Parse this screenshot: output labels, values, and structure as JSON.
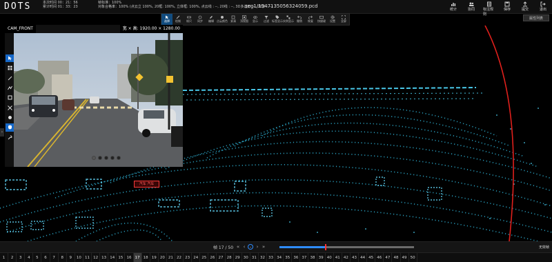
{
  "app": {
    "logo": "DOTS",
    "filename": "seg1/1547135056324059.pcd"
  },
  "metrics": [
    "本次时间 00：21：56",
    "帧标准：100%",
    "累计时间 01：33：23",
    "对象合格率：100% (点云立 100%, 20框: 100%, 立体框: 100%, 点云线 : --, 20线 : --, 3D多边形: --, 20多 : --)"
  ],
  "top_actions": [
    {
      "label": "统计",
      "icon": "chart-icon"
    },
    {
      "label": "协同",
      "icon": "users-icon"
    },
    {
      "label": "标注规则",
      "icon": "rules-icon"
    },
    {
      "label": "保存",
      "icon": "save-icon"
    },
    {
      "label": "提交",
      "icon": "submit-icon"
    },
    {
      "label": "退出",
      "icon": "exit-icon"
    }
  ],
  "toolbar": [
    {
      "label": "选择",
      "icon": "cursor-icon",
      "active": true
    },
    {
      "label": "绘制",
      "icon": "draw-icon"
    },
    {
      "label": "帧尺",
      "icon": "ruler-icon"
    },
    {
      "label": "同步",
      "icon": "sync-icon"
    },
    {
      "label": "编辑",
      "icon": "edit-icon"
    },
    {
      "label": "点云颜色",
      "icon": "color-icon"
    },
    {
      "label": "紧凑",
      "icon": "compact-icon"
    },
    {
      "label": "顶视图",
      "icon": "topview-icon"
    },
    {
      "label": "显示",
      "icon": "eye-icon"
    },
    {
      "label": "过滤",
      "icon": "filter-icon"
    },
    {
      "label": "标签显示",
      "icon": "tag-icon"
    },
    {
      "label": "实例显示",
      "icon": "instance-icon"
    },
    {
      "label": "撤销",
      "icon": "undo-icon"
    },
    {
      "label": "恢复",
      "icon": "redo-icon"
    },
    {
      "label": "快捷键",
      "icon": "keyboard-icon"
    },
    {
      "label": "设置",
      "icon": "settings-icon"
    },
    {
      "label": "全屏",
      "icon": "fullscreen-icon"
    }
  ],
  "properties_button": "属性列表",
  "camera": {
    "title": "CAM_FRONT",
    "resolution": "宽 × 高: 1920.00 × 1280.00",
    "dots": 5,
    "active_dot": 0
  },
  "annotation_tag": "汽车 汽车",
  "frame": {
    "label": "帧 17 / 50",
    "current": 17,
    "total": 50,
    "progress": 0.34,
    "marker": 0.34,
    "no_frame_label": "无效帧"
  },
  "frame_numbers": [
    "1",
    "2",
    "3",
    "4",
    "5",
    "6",
    "7",
    "8",
    "9",
    "10",
    "11",
    "12",
    "13",
    "14",
    "15",
    "16",
    "17",
    "18",
    "19",
    "20",
    "21",
    "22",
    "23",
    "24",
    "25",
    "26",
    "27",
    "28",
    "29",
    "30",
    "31",
    "32",
    "33",
    "34",
    "35",
    "36",
    "37",
    "38",
    "39",
    "40",
    "41",
    "42",
    "43",
    "44",
    "45",
    "46",
    "47",
    "48",
    "49",
    "50"
  ],
  "colors": {
    "accent": "#1668c8",
    "lidar": "#49c7e8",
    "tag": "#ff3b3b",
    "trajectory": "#e0201c"
  }
}
